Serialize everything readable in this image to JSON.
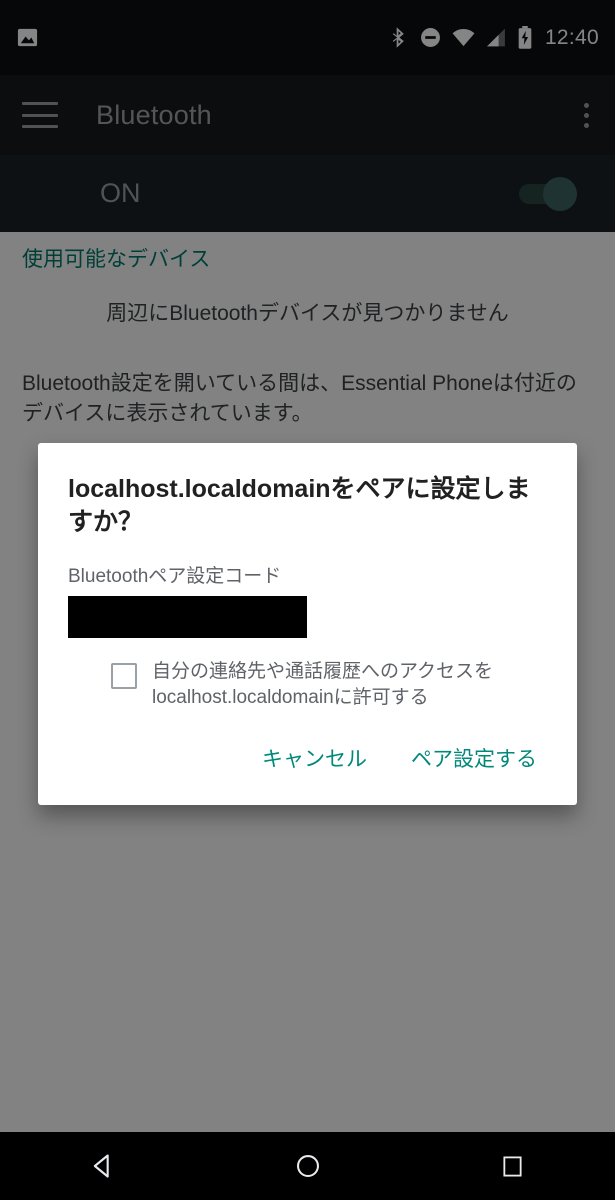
{
  "status_bar": {
    "notification_icon": "photo-icon",
    "icons": [
      "bluetooth-icon",
      "do-not-disturb-icon",
      "wifi-icon",
      "cellular-signal-icon",
      "battery-charging-icon"
    ],
    "time": "12:40",
    "background_color": "#0b0f11",
    "foreground_color": "#ffffff"
  },
  "app_bar": {
    "menu_icon": "hamburger-menu-icon",
    "title": "Bluetooth",
    "overflow_icon": "more-vert-icon",
    "background_color": "#16191c",
    "title_color": "#9fa5a8"
  },
  "toggle_row": {
    "label": "ON",
    "enabled": true,
    "accent_color": "#3d6560"
  },
  "content": {
    "section_header": "使用可能なデバイス",
    "section_header_color": "#00796b",
    "empty_message": "周辺にBluetoothデバイスが見つかりません",
    "footer_note": "Bluetooth設定を開いている間は、Essential Phoneは付近のデバイスに表示されています。"
  },
  "dialog": {
    "title": "localhost.localdomainをペアに設定しますか？",
    "code_label": "Bluetoothペア設定コード",
    "code_value": "",
    "code_redacted": true,
    "checkbox": {
      "checked": false,
      "label": "自分の連絡先や通話履歴へのアクセスをlocalhost.localdomainに許可する"
    },
    "cancel_label": "キャンセル",
    "confirm_label": "ペア設定する",
    "action_color": "#00897b",
    "background_color": "#ffffff"
  },
  "nav_bar": {
    "back_icon": "back-triangle-icon",
    "home_icon": "home-circle-icon",
    "recents_icon": "recents-square-icon",
    "background_color": "#000000"
  }
}
